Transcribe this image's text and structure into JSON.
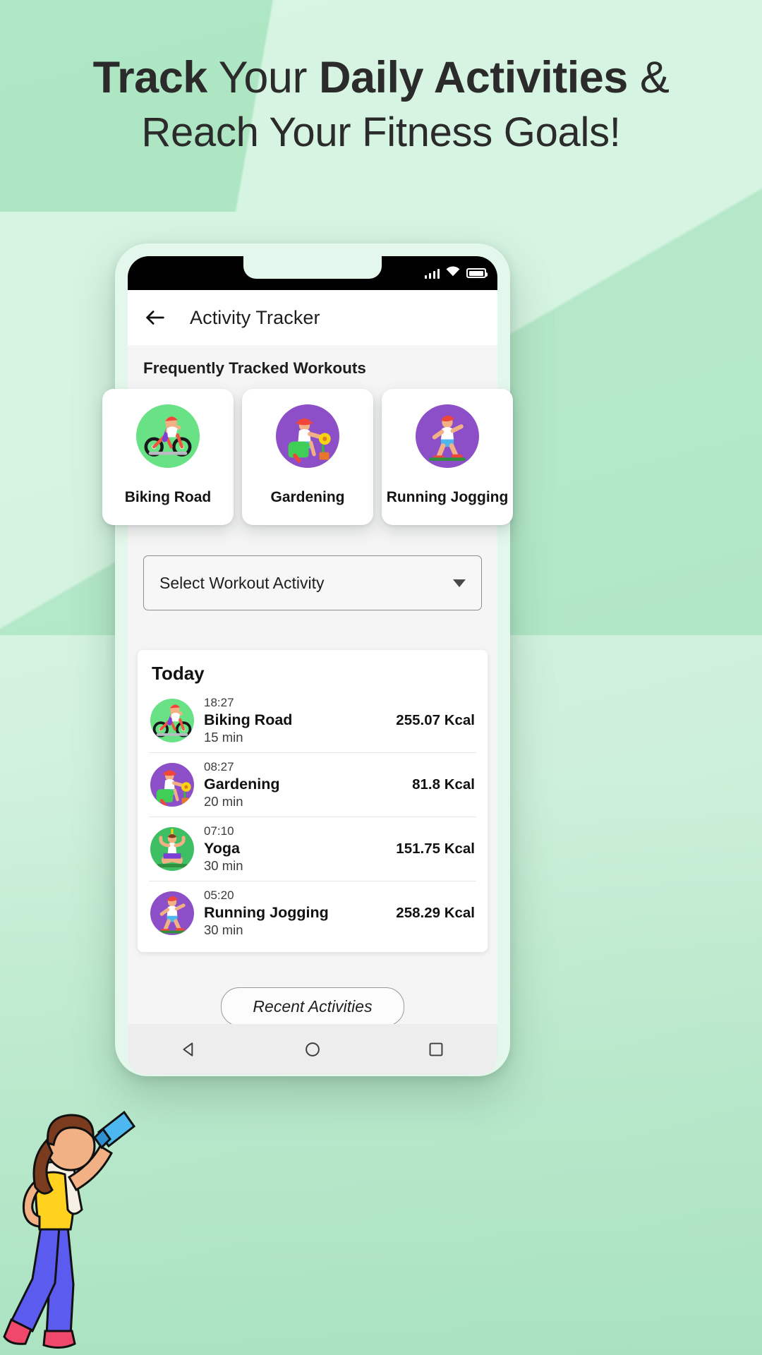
{
  "promo": {
    "headline_line1_a": "Track",
    "headline_line1_b": " Your ",
    "headline_line1_c": "Daily Activities",
    "headline_line1_d": " &",
    "headline_line2": "Reach Your Fitness Goals!"
  },
  "colors": {
    "background_light": "#d8f5e3",
    "background_deep": "#bfe9ce",
    "headline_text": "#2b2b2b",
    "accent_green": "#68e285",
    "accent_purple": "#8c4fc7",
    "card_white": "#ffffff",
    "screen_grey": "#f5f5f5"
  },
  "statusbar": {
    "signal_icon": "signal-bars-icon",
    "wifi_icon": "wifi-icon",
    "battery_icon": "battery-full-icon"
  },
  "appbar": {
    "back_icon": "back-arrow-icon",
    "title": "Activity Tracker"
  },
  "frequent": {
    "section_title": "Frequently Tracked Workouts",
    "cards": [
      {
        "label": "Biking Road",
        "icon": "cyclist-icon",
        "circle_color": "#68e285"
      },
      {
        "label": "Gardening",
        "icon": "gardener-icon",
        "circle_color": "#8c4fc7"
      },
      {
        "label": "Running Jogging",
        "icon": "runner-icon",
        "circle_color": "#8c4fc7"
      }
    ]
  },
  "dropdown": {
    "value": "Select Workout Activity",
    "caret_icon": "chevron-down-icon"
  },
  "today": {
    "title": "Today",
    "rows": [
      {
        "time": "18:27",
        "name": "Biking Road",
        "duration": "15 min",
        "kcal": "255.07 Kcal",
        "icon": "cyclist-icon",
        "circle_color": "#68e285"
      },
      {
        "time": "08:27",
        "name": "Gardening",
        "duration": "20 min",
        "kcal": "81.8 Kcal",
        "icon": "gardener-icon",
        "circle_color": "#8c4fc7"
      },
      {
        "time": "07:10",
        "name": "Yoga",
        "duration": "30 min",
        "kcal": "151.75 Kcal",
        "icon": "yoga-icon",
        "circle_color": "#3fbf63"
      },
      {
        "time": "05:20",
        "name": "Running Jogging",
        "duration": "30 min",
        "kcal": "258.29 Kcal",
        "icon": "runner-icon",
        "circle_color": "#8c4fc7"
      }
    ]
  },
  "recent_button": {
    "label": "Recent Activities"
  },
  "navbar": {
    "back_icon": "nav-back-triangle-icon",
    "home_icon": "nav-home-circle-icon",
    "recents_icon": "nav-recents-square-icon"
  },
  "illustration": {
    "name": "woman-drinking-water-illustration"
  }
}
